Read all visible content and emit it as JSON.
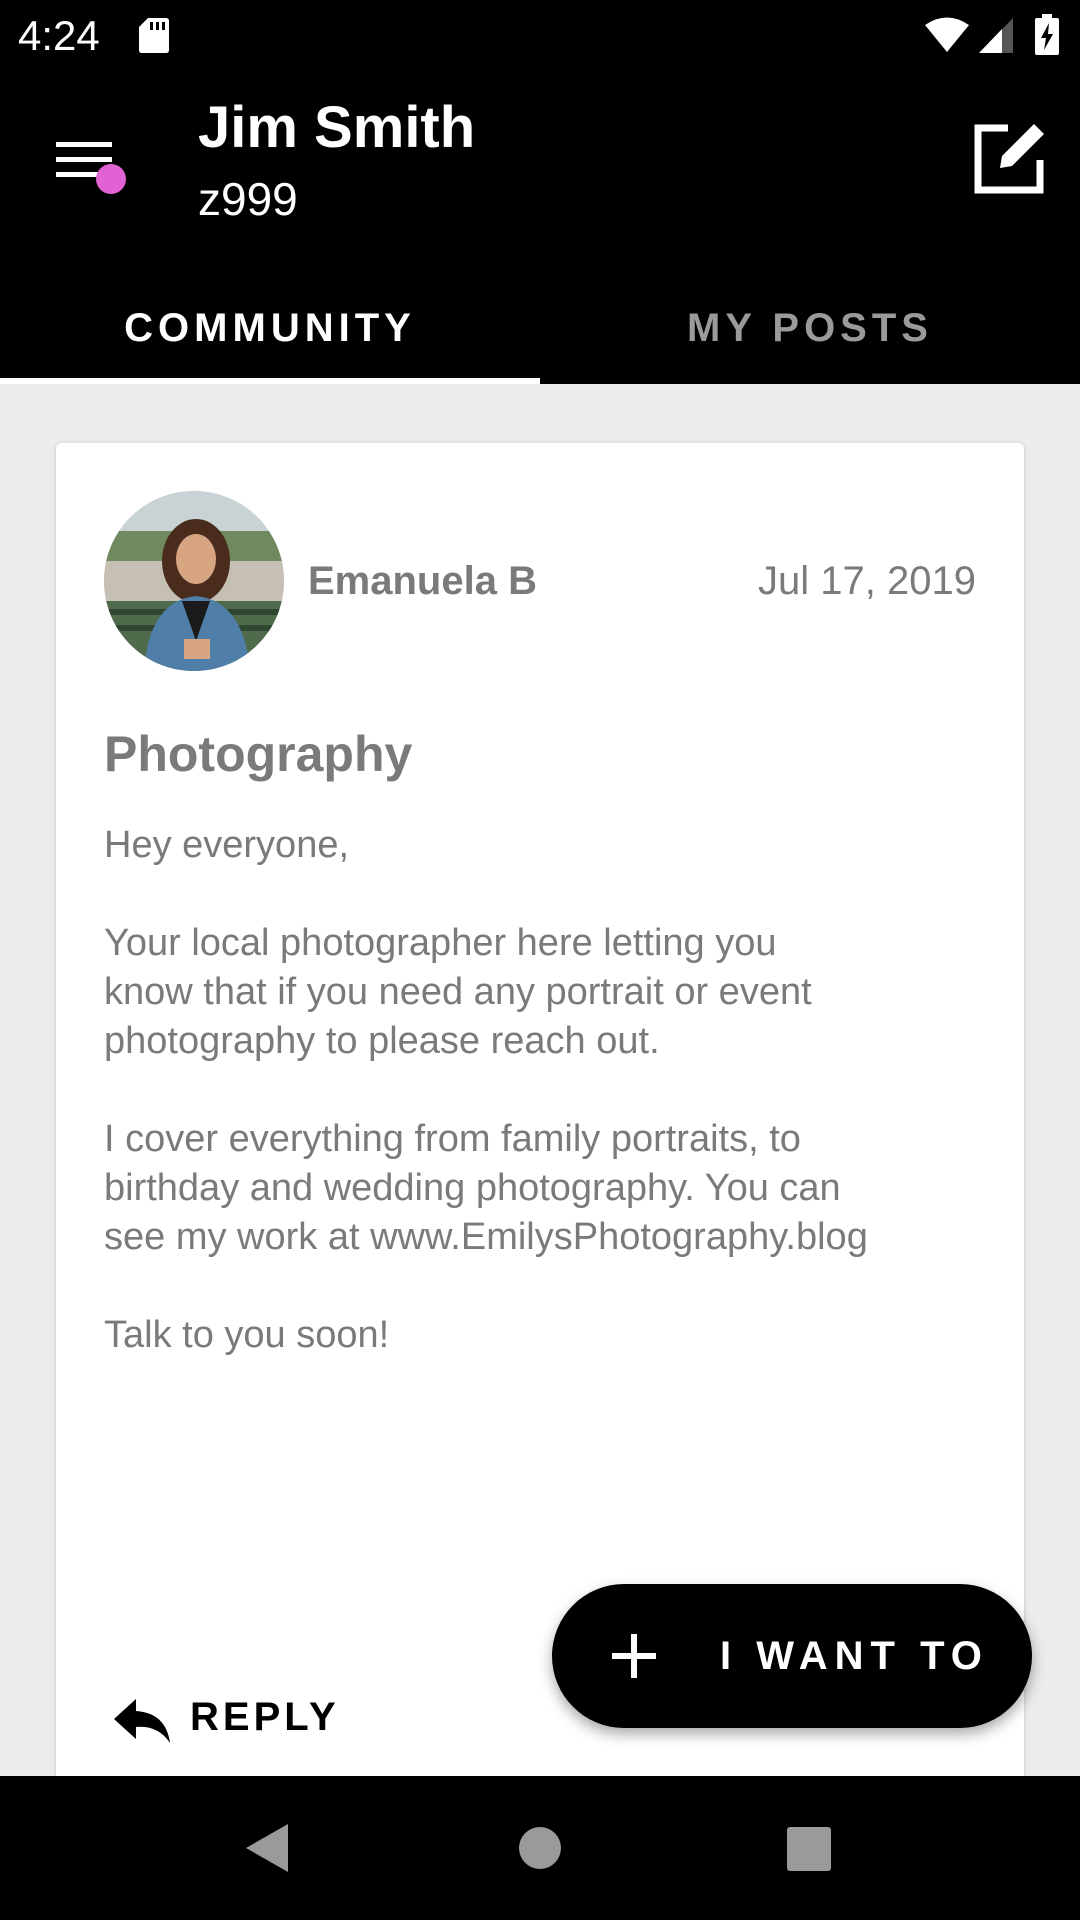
{
  "status_bar": {
    "time": "4:24",
    "icons": [
      "sd-card-icon",
      "wifi-icon",
      "signal-icon",
      "battery-charging-icon"
    ]
  },
  "header": {
    "user_name": "Jim Smith",
    "user_id": "z999",
    "menu_icon": "menu-icon",
    "compose_icon": "edit-icon",
    "notification_dot_color": "#e062d3"
  },
  "tabs": [
    {
      "label": "COMMUNITY",
      "selected": true
    },
    {
      "label": "MY POSTS",
      "selected": false
    }
  ],
  "post": {
    "author": "Emanuela B",
    "date": "Jul 17, 2019",
    "title": "Photography",
    "body": [
      "Hey everyone,",
      "Your local photographer here letting you\nknow that if you need any portrait or event\nphotography to please reach out.",
      "I cover everything from family portraits, to\nbirthday and wedding photography. You can\nsee my work at www.EmilysPhotography.blog",
      "Talk to you soon!"
    ],
    "reply_label": "REPLY"
  },
  "fab": {
    "label": "I WANT TO",
    "icon": "plus-icon"
  },
  "nav_bar": {
    "icons": [
      "back-icon",
      "home-icon",
      "recents-icon"
    ]
  },
  "colors": {
    "app_bar": "#000000",
    "background": "#ececec",
    "card": "#ffffff",
    "text_muted": "#7a7a7a",
    "tab_inactive": "#9a9a9a"
  }
}
